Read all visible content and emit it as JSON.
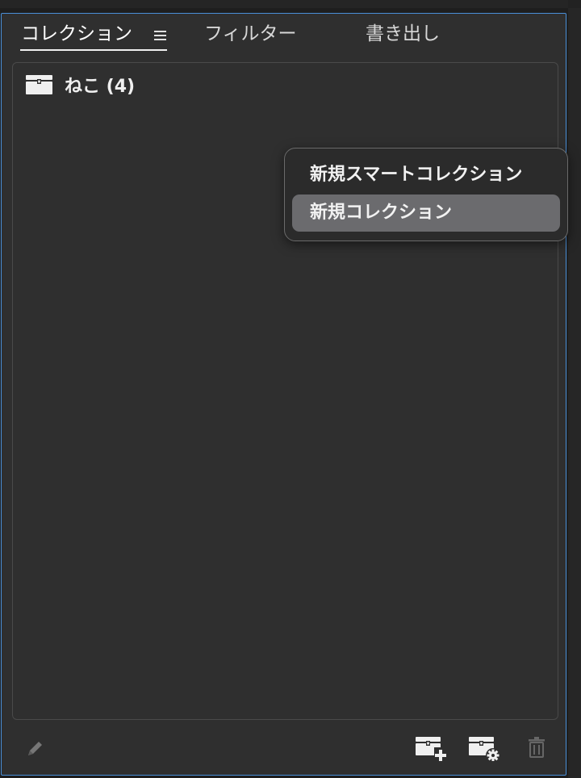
{
  "tabs": {
    "collections_label": "コレクション",
    "filter_label": "フィルター",
    "export_label": "書き出し"
  },
  "collections": [
    {
      "label": "ねこ (4)",
      "icon": "collection-box-icon"
    }
  ],
  "context_menu": {
    "items": [
      {
        "label": "新規スマートコレクション"
      },
      {
        "label": "新規コレクション",
        "highlighted": true
      }
    ]
  },
  "toolbar": {
    "icons": [
      "pencil-icon",
      "new-collection-icon",
      "smart-collection-icon",
      "trash-icon"
    ]
  },
  "colors": {
    "panel_background": "#2f2f2f",
    "focus_border": "#4a8fd8",
    "menu_highlight": "#6b6b6e"
  }
}
